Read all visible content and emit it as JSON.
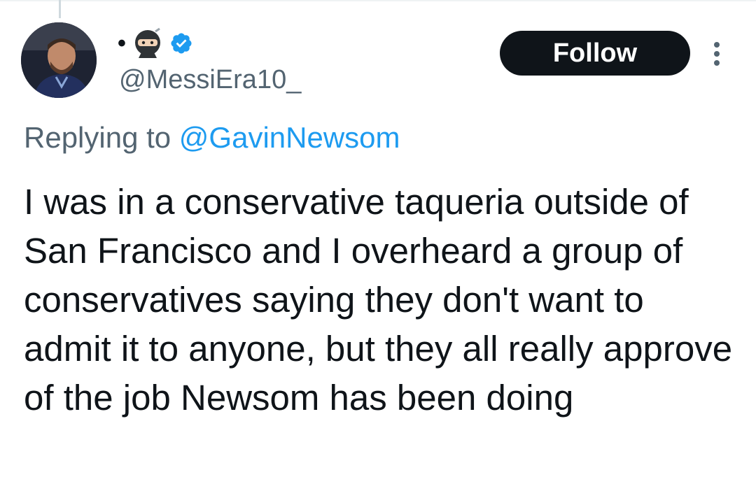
{
  "tweet": {
    "display_name_prefix": "•",
    "handle": "@MessiEra10_",
    "follow_label": "Follow",
    "replying_prefix": "Replying to ",
    "replying_handle": "@GavinNewsom",
    "text": "I was in a conservative taqueria outside of San Francisco and I overheard a group of conservatives saying they don't want to admit it to anyone, but they all really approve of the job Newsom has been doing"
  },
  "icons": {
    "name_emoji": "ninja-emoji-icon",
    "verified": "verified-badge-icon",
    "more": "more-vertical-icon"
  },
  "colors": {
    "text_primary": "#0f1419",
    "text_secondary": "#536471",
    "link_blue": "#1d9bf0",
    "verified_blue": "#1d9bf0",
    "follow_button_bg": "#0f1419"
  }
}
